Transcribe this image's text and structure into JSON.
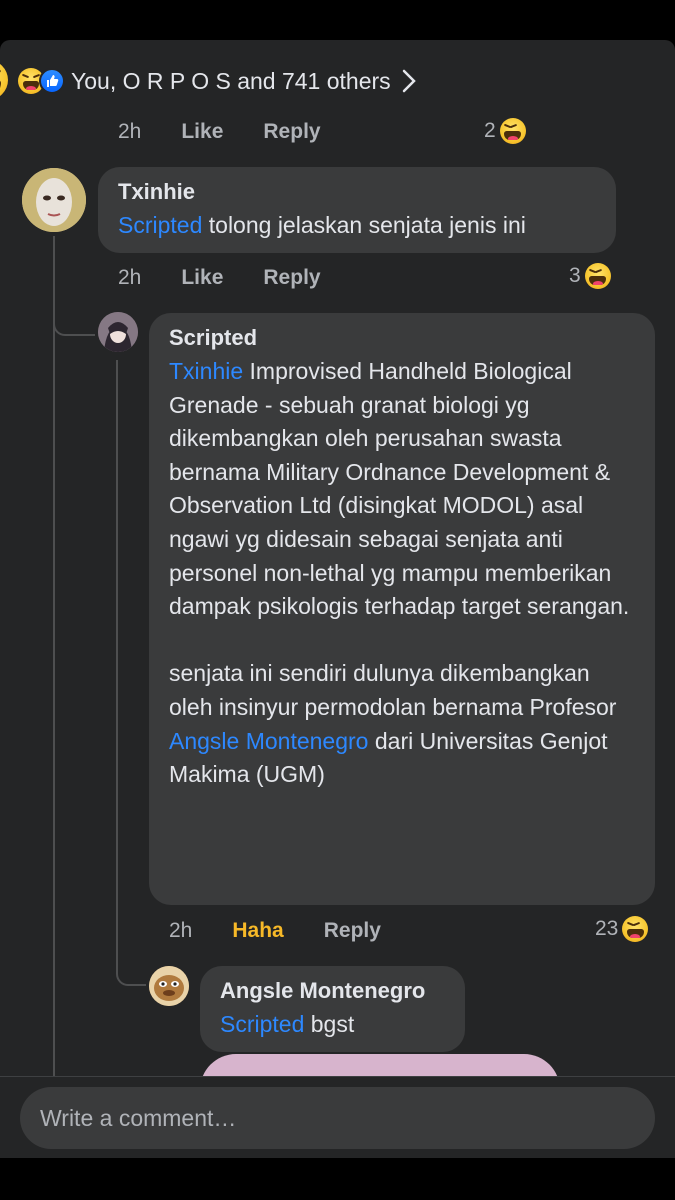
{
  "summary": {
    "text": "You, O R P O S and 741 others",
    "icons": [
      "haha-emoji-icon",
      "like-icon"
    ]
  },
  "comments": [
    {
      "time": "2h",
      "like": "Like",
      "reply": "Reply",
      "reaction_count": "2",
      "reaction_icon": "haha-emoji-icon"
    },
    {
      "author": "Txinhie",
      "mention": "Scripted",
      "text": " tolong jelaskan senjata jenis ini",
      "time": "2h",
      "like": "Like",
      "reply": "Reply",
      "reaction_count": "3",
      "reaction_icon": "haha-emoji-icon"
    },
    {
      "author": "Scripted",
      "mention": "Txinhie",
      "text_lines_1": " Improvised Handheld Biological Grenade - sebuah granat biologi yg dikembangkan oleh perusahan swasta bernama Military Ordnance Development & Observation Ltd (disingkat MODOL) asal ngawi yg didesain sebagai senjata anti personel non-lethal yg mampu memberikan dampak psikologis terhadap target serangan.",
      "text_2a": "senjata ini sendiri dulunya dikembangkan oleh insinyur permodolan bernama Profesor ",
      "mention_2": "Angsle Montenegro",
      "text_2b": " dari Universitas Genjot Makima (UGM)",
      "time": "2h",
      "like": "Haha",
      "reply": "Reply",
      "reaction_count": "23",
      "reaction_icon": "haha-emoji-icon",
      "like_color": "#f7b928"
    },
    {
      "author": "Angsle Montenegro",
      "mention": "Scripted",
      "text": " bgst"
    }
  ],
  "composer": {
    "placeholder": "Write a comment…"
  },
  "colors": {
    "background": "#242526",
    "bubble": "#3a3b3c",
    "mention": "#2d88ff",
    "haha": "#f7b928"
  }
}
